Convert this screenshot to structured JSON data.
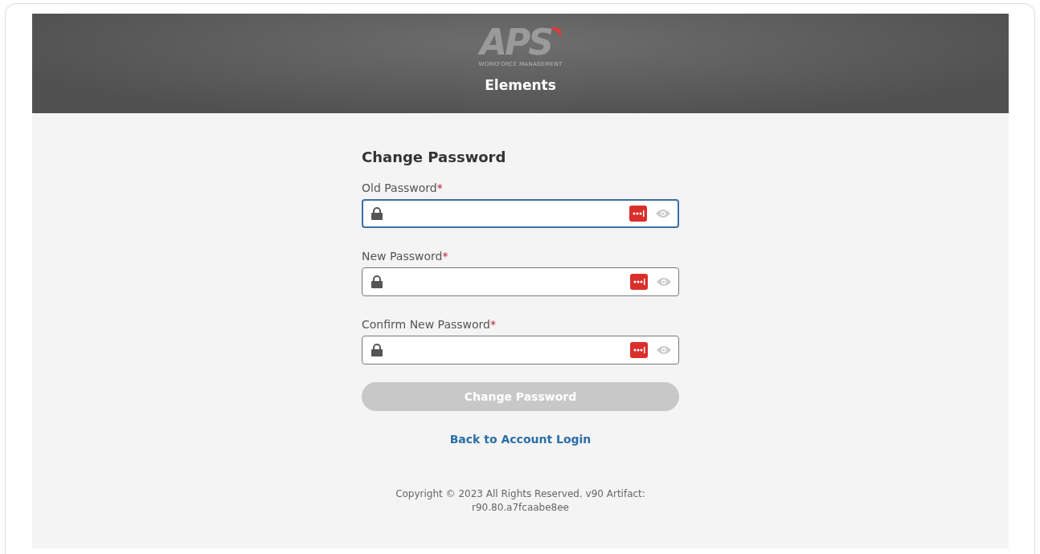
{
  "header": {
    "logo": {
      "mark": "APS",
      "tagline": "WORKFORCE MANAGEMENT"
    },
    "title": "Elements"
  },
  "form": {
    "title": "Change Password",
    "fields": [
      {
        "label": "Old Password",
        "required_mark": "*",
        "focused": true
      },
      {
        "label": "New Password",
        "required_mark": "*",
        "focused": false
      },
      {
        "label": "Confirm New Password",
        "required_mark": "*",
        "focused": false
      }
    ],
    "submit": {
      "label": "Change Password",
      "disabled": true
    },
    "link": "Back to Account Login"
  },
  "footer": {
    "lines": [
      "Copyright © 2023 All Rights Reserved. v90 Artifact:",
      "r90.80.a7fcaabe8ee"
    ]
  }
}
